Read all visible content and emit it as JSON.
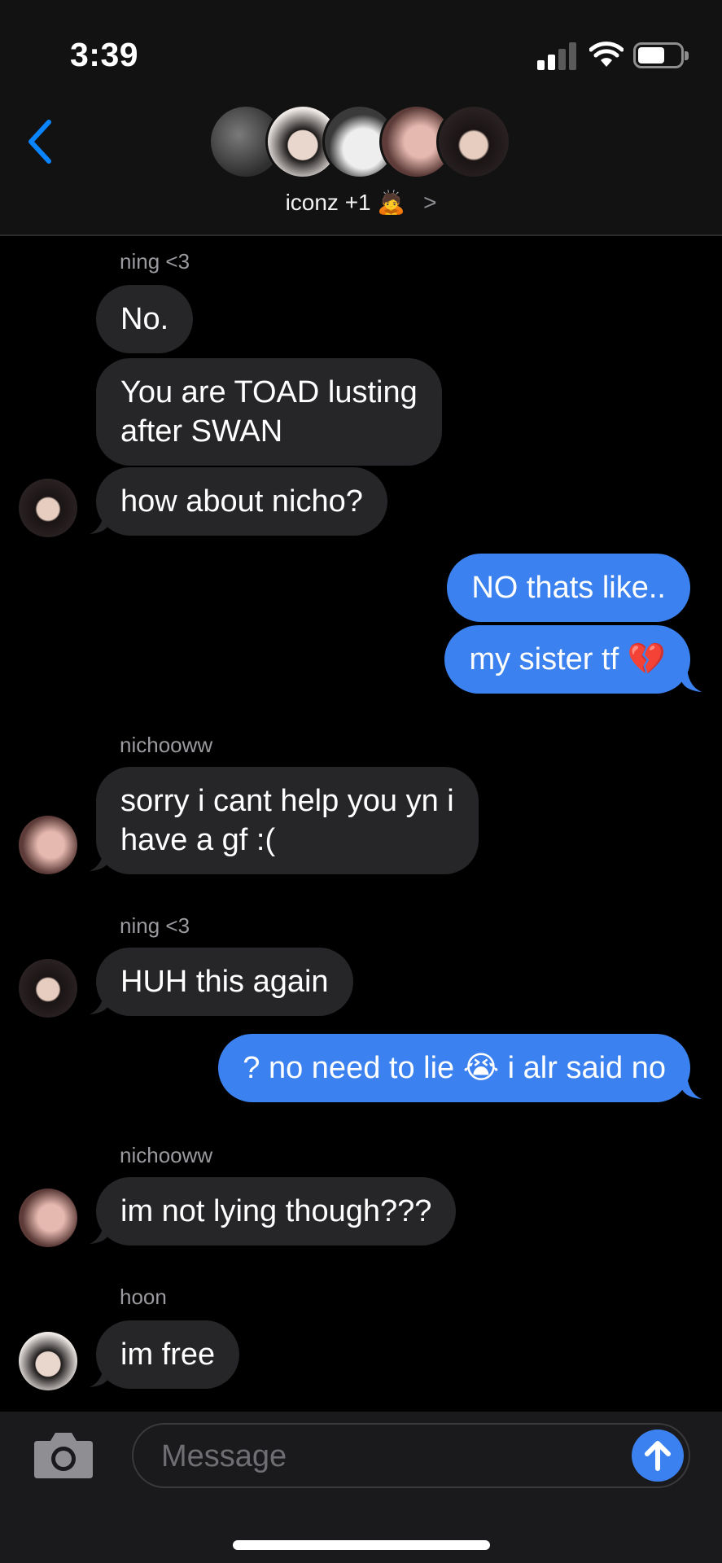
{
  "status": {
    "time": "3:39"
  },
  "header": {
    "group_name": "iconz +1",
    "group_emoji": "🙇",
    "arrow": ">"
  },
  "messages": [
    {
      "sender": "ning <3",
      "text": "No."
    },
    {
      "text": "You are TOAD lusting\nafter SWAN"
    },
    {
      "text": "how about nicho?"
    },
    {
      "text": "NO thats like.."
    },
    {
      "text": "my sister tf 💔"
    },
    {
      "sender": "nichooww",
      "text": "sorry i cant help you yn i\nhave a gf :("
    },
    {
      "sender": "ning <3",
      "text": "HUH this again"
    },
    {
      "text": "? no need to lie 😭 i alr said no"
    },
    {
      "sender": "nichooww",
      "text": "im not lying though???"
    },
    {
      "sender": "hoon",
      "text": "im free"
    }
  ],
  "composer": {
    "placeholder": "Message"
  },
  "colors": {
    "outgoing": "#3b82f0",
    "incoming": "#262629",
    "background": "#000000",
    "accent": "#0a84ff"
  }
}
